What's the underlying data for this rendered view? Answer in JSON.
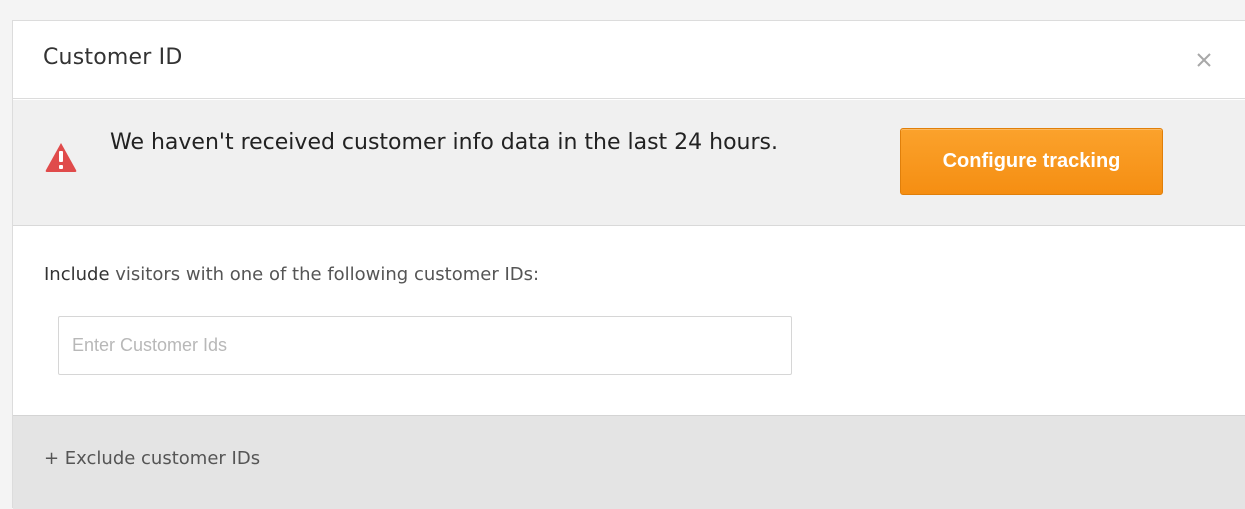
{
  "dialog": {
    "title": "Customer ID",
    "close_icon": "close-icon"
  },
  "alert": {
    "icon": "warning-triangle-icon",
    "icon_color": "#e04b4b",
    "message": "We haven't received customer info data in the last 24 hours.",
    "button_label": "Configure tracking",
    "button_color": "#f7941d"
  },
  "include": {
    "keyword": "Include",
    "rest": " visitors with one of the following customer IDs:",
    "input_value": "",
    "input_placeholder": "Enter Customer Ids"
  },
  "exclude": {
    "label": "+ Exclude customer IDs"
  }
}
